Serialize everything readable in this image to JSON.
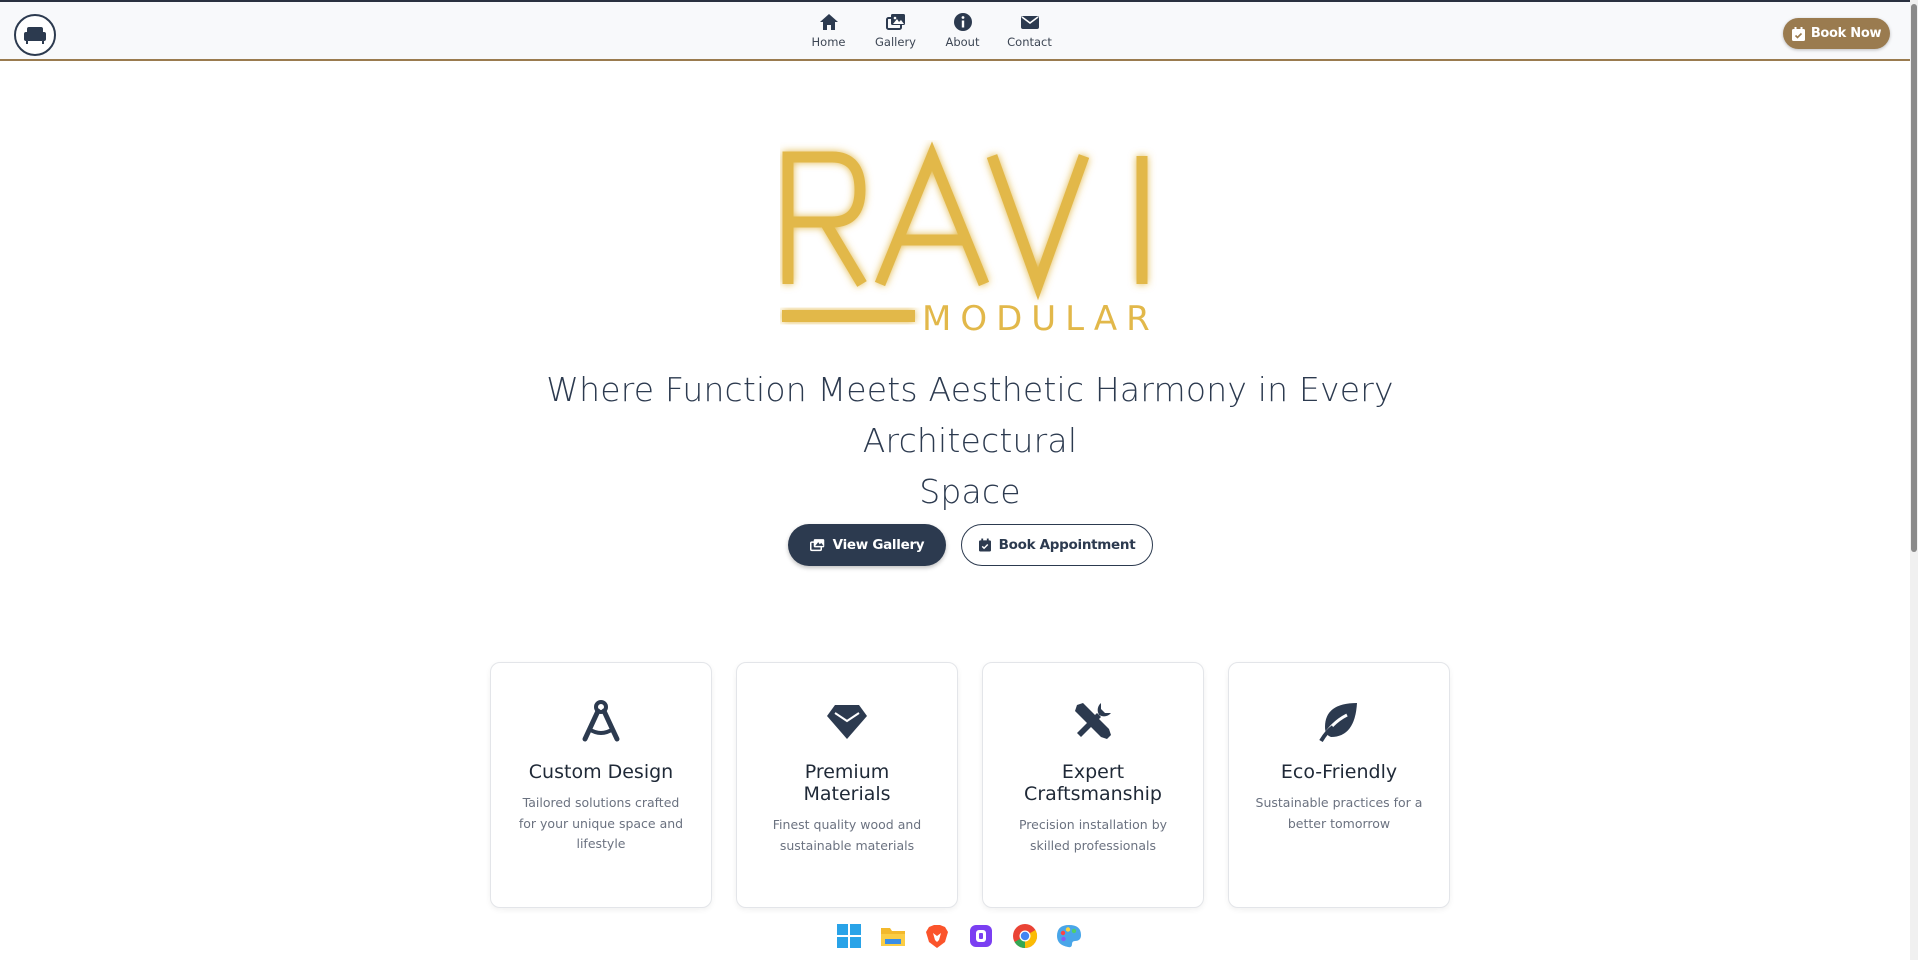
{
  "nav": {
    "items": [
      {
        "label": "Home",
        "icon": "home-icon"
      },
      {
        "label": "Gallery",
        "icon": "images-icon"
      },
      {
        "label": "About",
        "icon": "info-icon"
      },
      {
        "label": "Contact",
        "icon": "envelope-icon"
      }
    ],
    "book_now": "Book Now"
  },
  "hero": {
    "brand_main": "RAVI",
    "brand_sub": "MODULAR",
    "tagline_line1": "Where Function Meets Aesthetic Harmony in Every Architectural",
    "tagline_line2": "Space",
    "view_gallery": "View Gallery",
    "book_appointment": "Book Appointment"
  },
  "features": [
    {
      "title": "Custom Design",
      "desc": "Tailored solutions crafted for your unique space and lifestyle",
      "icon": "compass-drafting-icon"
    },
    {
      "title": "Premium Materials",
      "desc": "Finest quality wood and sustainable materials",
      "icon": "gem-icon"
    },
    {
      "title": "Expert Craftsmanship",
      "desc": "Precision installation by skilled professionals",
      "icon": "tools-icon"
    },
    {
      "title": "Eco-Friendly",
      "desc": "Sustainable practices for a better tomorrow",
      "icon": "leaf-icon"
    }
  ],
  "colors": {
    "navy": "#2c3a4f",
    "bronze": "#9a7b4f",
    "gold": "#e2b84a"
  },
  "taskbar": [
    "windows-icon",
    "file-explorer-icon",
    "brave-icon",
    "app-icon",
    "chrome-icon",
    "paint-icon"
  ]
}
